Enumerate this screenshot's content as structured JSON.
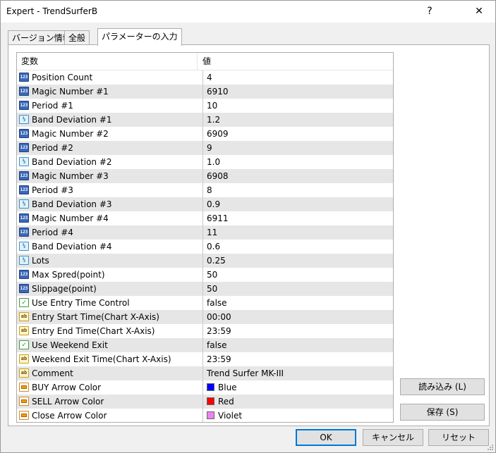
{
  "window": {
    "title": "Expert - TrendSurferB",
    "help_label": "?",
    "close_label": "✕"
  },
  "tabs": [
    {
      "label": "バージョン情報"
    },
    {
      "label": "全般"
    },
    {
      "label": "パラメーターの入力"
    }
  ],
  "active_tab": 2,
  "grid": {
    "header": {
      "name": "変数",
      "value": "値"
    },
    "rows": [
      {
        "type": "int",
        "icon": "int-param-icon",
        "name": "Position Count",
        "value": "4"
      },
      {
        "type": "int",
        "icon": "int-param-icon",
        "name": "Magic Number #1",
        "value": "6910"
      },
      {
        "type": "int",
        "icon": "int-param-icon",
        "name": "Period #1",
        "value": "10"
      },
      {
        "type": "dbl",
        "icon": "double-param-icon",
        "name": "Band Deviation #1",
        "value": "1.2"
      },
      {
        "type": "int",
        "icon": "int-param-icon",
        "name": "Magic Number #2",
        "value": "6909"
      },
      {
        "type": "int",
        "icon": "int-param-icon",
        "name": "Period #2",
        "value": "9"
      },
      {
        "type": "dbl",
        "icon": "double-param-icon",
        "name": "Band Deviation #2",
        "value": "1.0"
      },
      {
        "type": "int",
        "icon": "int-param-icon",
        "name": "Magic Number #3",
        "value": "6908"
      },
      {
        "type": "int",
        "icon": "int-param-icon",
        "name": "Period #3",
        "value": "8"
      },
      {
        "type": "dbl",
        "icon": "double-param-icon",
        "name": "Band Deviation #3",
        "value": "0.9"
      },
      {
        "type": "int",
        "icon": "int-param-icon",
        "name": "Magic Number #4",
        "value": "6911"
      },
      {
        "type": "int",
        "icon": "int-param-icon",
        "name": "Period #4",
        "value": "11"
      },
      {
        "type": "dbl",
        "icon": "double-param-icon",
        "name": "Band Deviation #4",
        "value": "0.6"
      },
      {
        "type": "dbl",
        "icon": "double-param-icon",
        "name": "Lots",
        "value": "0.25"
      },
      {
        "type": "int",
        "icon": "int-param-icon",
        "name": "Max Spred(point)",
        "value": "50"
      },
      {
        "type": "int",
        "icon": "int-param-icon",
        "name": "Slippage(point)",
        "value": "50"
      },
      {
        "type": "bool",
        "icon": "bool-param-icon",
        "name": "Use Entry Time Control",
        "value": "false"
      },
      {
        "type": "str",
        "icon": "string-param-icon",
        "name": "Entry Start Time(Chart X-Axis)",
        "value": "00:00"
      },
      {
        "type": "str",
        "icon": "string-param-icon",
        "name": "Entry End Time(Chart X-Axis)",
        "value": "23:59"
      },
      {
        "type": "bool",
        "icon": "bool-param-icon",
        "name": "Use Weekend Exit",
        "value": "false"
      },
      {
        "type": "str",
        "icon": "string-param-icon",
        "name": "Weekend Exit Time(Chart X-Axis)",
        "value": "23:59"
      },
      {
        "type": "str",
        "icon": "string-param-icon",
        "name": "Comment",
        "value": "Trend Surfer MK-III"
      },
      {
        "type": "clr",
        "icon": "color-param-icon",
        "name": "BUY Arrow Color",
        "value": "Blue",
        "swatch": "#0000ff"
      },
      {
        "type": "clr",
        "icon": "color-param-icon",
        "name": "SELL Arrow Color",
        "value": "Red",
        "swatch": "#ff0000"
      },
      {
        "type": "clr",
        "icon": "color-param-icon",
        "name": "Close Arrow Color",
        "value": "Violet",
        "swatch": "#ee82ee"
      }
    ]
  },
  "side_buttons": {
    "load": "読み込み (L)",
    "save": "保存 (S)"
  },
  "footer_buttons": {
    "ok": "OK",
    "cancel": "キャンセル",
    "reset": "リセット"
  },
  "colors": {
    "accent": "#0078d7",
    "int_icon": "#3a67b8",
    "stripe": "#e6e6e6"
  }
}
